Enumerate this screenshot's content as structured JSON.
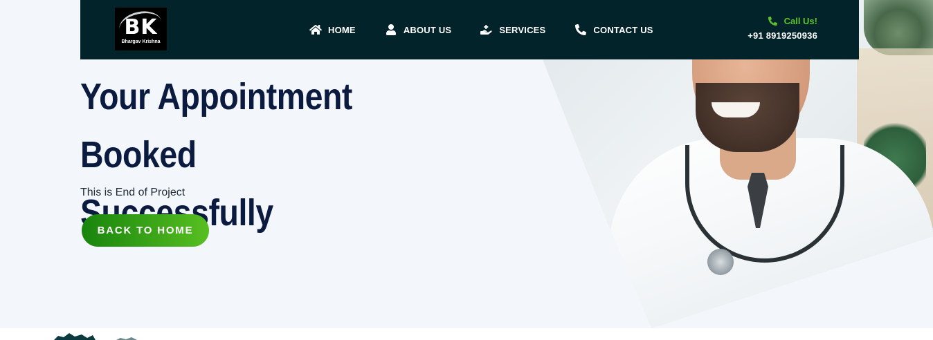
{
  "brand": {
    "logo_letters": "BK",
    "logo_subtitle": "Bhargav Krishna"
  },
  "nav": {
    "items": [
      {
        "label": "HOME",
        "icon": "home-icon"
      },
      {
        "label": "ABOUT US",
        "icon": "user-icon"
      },
      {
        "label": "SERVICES",
        "icon": "medical-hand-icon"
      },
      {
        "label": "CONTACT US",
        "icon": "phone-icon"
      }
    ]
  },
  "contact": {
    "call_label": "Call Us!",
    "phone": "+91 8919250936",
    "icon": "phone-icon"
  },
  "hero": {
    "title_line1": "Your Appointment Booked",
    "title_line2": "Successfully",
    "subtitle": "This is End of Project",
    "button_label": "BACK TO HOME"
  },
  "colors": {
    "navbar_bg": "#03232a",
    "accent_green": "#5bc42c",
    "button_gradient_start": "#18840d",
    "button_gradient_end": "#58bf21",
    "title_color": "#0b1a3f",
    "hero_bg": "#f3f7fc"
  }
}
